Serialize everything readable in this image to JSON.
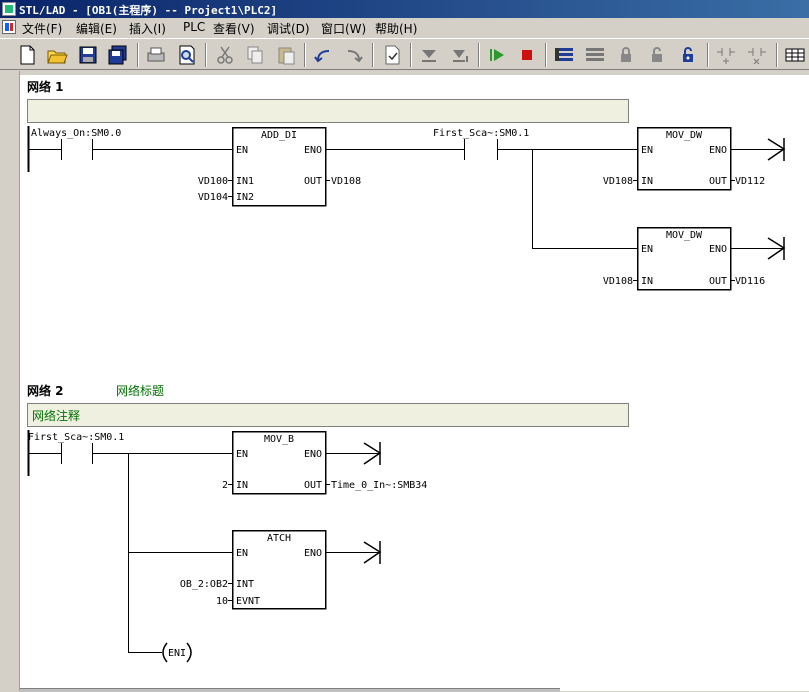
{
  "window": {
    "title": "STL/LAD - [OB1(主程序) -- Project1\\PLC2]"
  },
  "menu": [
    "文件(F)",
    "编辑(E)",
    "插入(I)",
    "PLC",
    "查看(V)",
    "调试(D)",
    "窗口(W)",
    "帮助(H)"
  ],
  "toolbar_icons": [
    "new-icon",
    "open-icon",
    "save-icon",
    "save-all-icon",
    "print-icon",
    "print-preview-icon",
    "cut-icon",
    "copy-icon",
    "paste-icon",
    "undo-icon",
    "redo-icon",
    "compile-icon",
    "download-icon",
    "upload-icon",
    "run-icon",
    "stop-icon",
    "program-status-icon",
    "data-status-icon",
    "lock-icon",
    "unlock-icon",
    "force-icon",
    "insert-contact-icon",
    "delete-contact-icon",
    "table-icon"
  ],
  "network1": {
    "title": "网络 1",
    "contact1": "Always_On:SM0.0",
    "add_di": {
      "name": "ADD_DI",
      "en": "EN",
      "eno": "ENO",
      "in1": "IN1",
      "in2": "IN2",
      "out": "OUT",
      "in1_val": "VD100",
      "in2_val": "VD104",
      "out_val": "VD108"
    },
    "contact2": "First_Sca~:SM0.1",
    "mov1": {
      "name": "MOV_DW",
      "en": "EN",
      "eno": "ENO",
      "in": "IN",
      "out": "OUT",
      "in_val": "VD108",
      "out_val": "VD112"
    },
    "mov2": {
      "name": "MOV_DW",
      "en": "EN",
      "eno": "ENO",
      "in": "IN",
      "out": "OUT",
      "in_val": "VD108",
      "out_val": "VD116"
    }
  },
  "network2": {
    "title": "网络 2",
    "subtitle": "网络标题",
    "comment": "网络注释",
    "contact1": "First_Sca~:SM0.1",
    "mov_b": {
      "name": "MOV_B",
      "en": "EN",
      "eno": "ENO",
      "in": "IN",
      "out": "OUT",
      "in_val": "2",
      "out_val": "Time_0_In~:SMB34"
    },
    "atch": {
      "name": "ATCH",
      "en": "EN",
      "eno": "ENO",
      "int": "INT",
      "evnt": "EVNT",
      "int_val": "OB_2:OB2",
      "evnt_val": "10"
    },
    "eni": "ENI"
  }
}
